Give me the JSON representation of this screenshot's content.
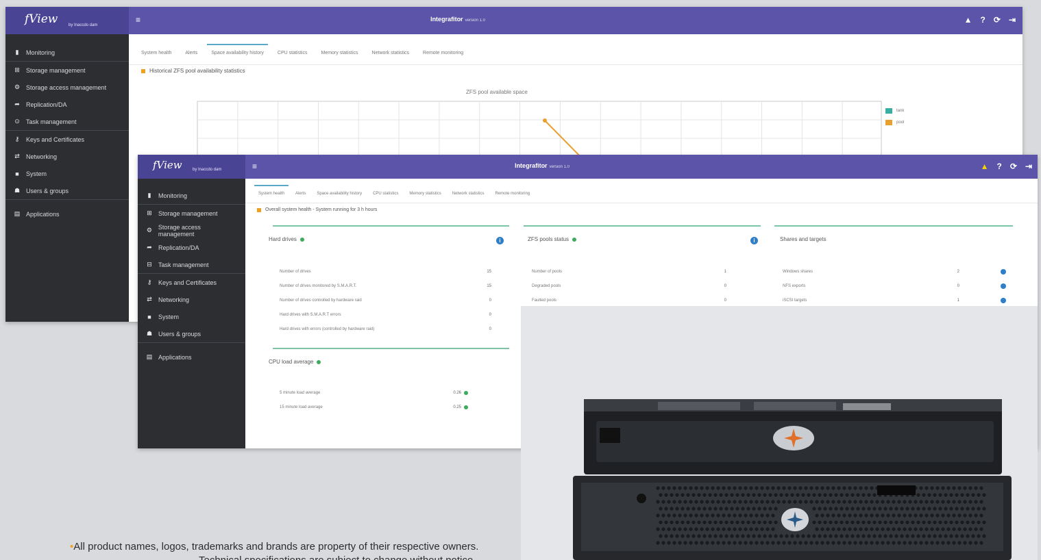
{
  "app": {
    "logo_text": "fView",
    "logo_sub": "by Inaccdo dam",
    "title": "Integrafitor",
    "version": "version 1.0",
    "menu_icon": "hamburger-icon",
    "top_icons": [
      "warning-icon",
      "help-icon",
      "refresh-icon",
      "logout-icon"
    ],
    "top_icon_glyphs": [
      "▲",
      "?",
      "⟳",
      "⇥"
    ]
  },
  "back_window": {
    "sidebar": [
      {
        "icon": "file-icon",
        "glyph": "▮",
        "label": "Monitoring"
      },
      {
        "icon": "storage-icon",
        "glyph": "⊞",
        "label": "Storage management"
      },
      {
        "icon": "access-icon",
        "glyph": "⚙",
        "label": "Storage access management"
      },
      {
        "icon": "replication-icon",
        "glyph": "➦",
        "label": "Replication/DA"
      },
      {
        "icon": "task-icon",
        "glyph": "⊙",
        "label": "Task management"
      },
      {
        "icon": "key-icon",
        "glyph": "⚷",
        "label": "Keys and Certificates"
      },
      {
        "icon": "network-icon",
        "glyph": "⇄",
        "label": "Networking"
      },
      {
        "icon": "system-icon",
        "glyph": "■",
        "label": "System"
      },
      {
        "icon": "users-icon",
        "glyph": "☗",
        "label": "Users & groups"
      },
      {
        "icon": "apps-icon",
        "glyph": "▤",
        "label": "Applications"
      }
    ],
    "tabs": [
      "System health",
      "Alerts",
      "Space availability history",
      "CPU statistics",
      "Memory statistics",
      "Network statistics",
      "Remote monitoring"
    ],
    "active_tab": 2,
    "section_title": "Historical ZFS pool availability statistics",
    "chart_data": {
      "type": "line",
      "title": "ZFS pool available space",
      "series": [
        {
          "name": "tank",
          "color": "#3aaea0",
          "values": []
        },
        {
          "name": "pool",
          "color": "#e8a030",
          "values": []
        }
      ],
      "legend_position": "right",
      "grid": true
    }
  },
  "front_window": {
    "sidebar": [
      {
        "icon": "file-icon",
        "glyph": "▮",
        "label": "Monitoring"
      },
      {
        "icon": "storage-icon",
        "glyph": "⊞",
        "label": "Storage management"
      },
      {
        "icon": "access-icon",
        "glyph": "⚙",
        "label": "Storage access management"
      },
      {
        "icon": "replication-icon",
        "glyph": "➦",
        "label": "Replication/DA"
      },
      {
        "icon": "task-icon",
        "glyph": "⊟",
        "label": "Task management"
      },
      {
        "icon": "key-icon",
        "glyph": "⚷",
        "label": "Keys and Certificates"
      },
      {
        "icon": "network-icon",
        "glyph": "⇄",
        "label": "Networking"
      },
      {
        "icon": "system-icon",
        "glyph": "■",
        "label": "System"
      },
      {
        "icon": "users-icon",
        "glyph": "☗",
        "label": "Users & groups"
      },
      {
        "icon": "apps-icon",
        "glyph": "▤",
        "label": "Applications"
      }
    ],
    "tabs": [
      "System health",
      "Alerts",
      "Space availability history",
      "CPU statistics",
      "Memory statistics",
      "Network statistics",
      "Remote monitoring"
    ],
    "active_tab": 0,
    "section_title": "Overall system health - System running for 3 h hours",
    "hard_drives": {
      "title": "Hard drives",
      "rows": [
        {
          "label": "Number of drives",
          "value": "15"
        },
        {
          "label": "Number of drives monitored by S.M.A.R.T.",
          "value": "15"
        },
        {
          "label": "Number of drives controlled by hardware raid",
          "value": "0"
        },
        {
          "label": "Hard drives with S.M.A.R.T errors",
          "value": "0"
        },
        {
          "label": "Hard drives with errors (controlled by hardware raid)",
          "value": "0"
        }
      ]
    },
    "zfs_pools": {
      "title": "ZFS pools status",
      "rows": [
        {
          "label": "Number of pools",
          "value": "1"
        },
        {
          "label": "Degraded pools",
          "value": "0"
        },
        {
          "label": "Faulted pools",
          "value": "0"
        }
      ]
    },
    "shares": {
      "title": "Shares and targets",
      "rows": [
        {
          "label": "Windows shares",
          "value": "2"
        },
        {
          "label": "NFS exports",
          "value": "0"
        },
        {
          "label": "iSCSI targets",
          "value": "1"
        }
      ]
    },
    "cpu": {
      "title": "CPU load average",
      "rows": [
        {
          "label": "5 minute load average",
          "value": "0.26"
        },
        {
          "label": "15 minute load average",
          "value": "0.25"
        }
      ]
    }
  },
  "disclaimer": {
    "line1": "All product names, logos, trademarks and brands are property of their respective owners.",
    "line2": "Technical specifications are subject to change without notice."
  }
}
